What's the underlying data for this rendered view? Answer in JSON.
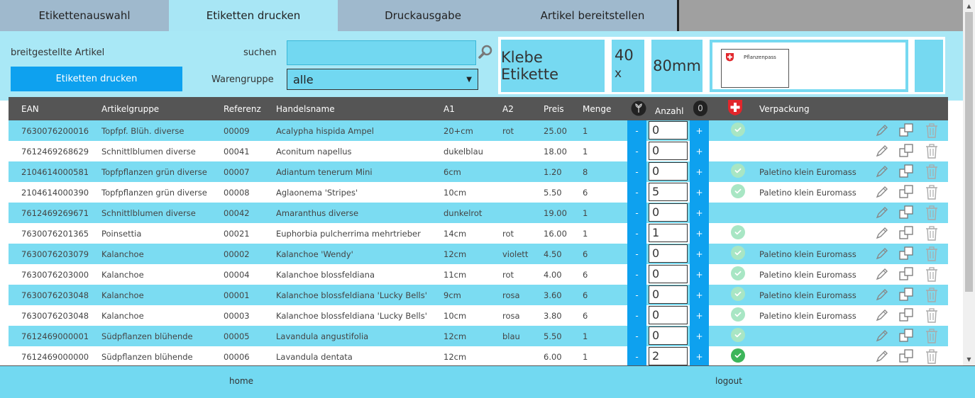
{
  "tabs": [
    {
      "label": "Etikettenauswahl"
    },
    {
      "label": "Etiketten drucken"
    },
    {
      "label": "Druckausgabe"
    },
    {
      "label": "Artikel bereitstellen"
    }
  ],
  "panel": {
    "provided_label": "breitgestellte Artikel",
    "print_button": "Etiketten drucken",
    "search_label": "suchen",
    "search_value": "",
    "group_label": "Warengruppe",
    "group_selected": "alle",
    "label_type": "Klebe Etikette",
    "label_width": "40",
    "label_x": "x",
    "label_height": "80mm",
    "pflanzenpass": "Pflanzenpass"
  },
  "columns": {
    "ean": "EAN",
    "group": "Artikelgruppe",
    "ref": "Referenz",
    "name": "Handelsname",
    "a1": "A1",
    "a2": "A2",
    "price": "Preis",
    "qty": "Menge",
    "count": "Anzahl",
    "count_total": "0",
    "packaging": "Verpackung"
  },
  "rows": [
    {
      "ean": "7630076200016",
      "group": "Topfpf. Blüh. diverse",
      "ref": "00009",
      "name": "Acalypha hispida Ampel",
      "a1": "20+cm",
      "a2": "rot",
      "price": "25.00",
      "qty": "1",
      "count": "0",
      "check": "light",
      "packaging": ""
    },
    {
      "ean": "7612469268629",
      "group": "Schnittlblumen diverse",
      "ref": "00041",
      "name": "Aconitum napellus",
      "a1": "dukelblau",
      "a2": "",
      "price": "18.00",
      "qty": "1",
      "count": "0",
      "check": "none",
      "packaging": ""
    },
    {
      "ean": "2104614000581",
      "group": "Topfpflanzen grün diverse",
      "ref": "00007",
      "name": "Adiantum tenerum Mini",
      "a1": "6cm",
      "a2": "",
      "price": "1.20",
      "qty": "8",
      "count": "0",
      "check": "light",
      "packaging": "Paletino klein Euromass"
    },
    {
      "ean": "2104614000390",
      "group": "Topfpflanzen grün diverse",
      "ref": "00008",
      "name": "Aglaonema 'Stripes'",
      "a1": "10cm",
      "a2": "",
      "price": "5.50",
      "qty": "6",
      "count": "5",
      "check": "light",
      "packaging": "Paletino klein Euromass"
    },
    {
      "ean": "7612469269671",
      "group": "Schnittlblumen diverse",
      "ref": "00042",
      "name": "Amaranthus diverse",
      "a1": "dunkelrot",
      "a2": "",
      "price": "19.00",
      "qty": "1",
      "count": "0",
      "check": "none",
      "packaging": ""
    },
    {
      "ean": "7630076201365",
      "group": "Poinsettia",
      "ref": "00021",
      "name": "Euphorbia pulcherrima mehrtrieber",
      "a1": "14cm",
      "a2": "rot",
      "price": "16.00",
      "qty": "1",
      "count": "1",
      "check": "light",
      "packaging": ""
    },
    {
      "ean": "7630076203079",
      "group": "Kalanchoe",
      "ref": "00002",
      "name": "Kalanchoe 'Wendy'",
      "a1": "12cm",
      "a2": "violett",
      "price": "4.50",
      "qty": "6",
      "count": "0",
      "check": "light",
      "packaging": "Paletino klein Euromass"
    },
    {
      "ean": "7630076203000",
      "group": "Kalanchoe",
      "ref": "00004",
      "name": "Kalanchoe blossfeldiana",
      "a1": "11cm",
      "a2": "rot",
      "price": "4.00",
      "qty": "6",
      "count": "0",
      "check": "light",
      "packaging": "Paletino klein Euromass"
    },
    {
      "ean": "7630076203048",
      "group": "Kalanchoe",
      "ref": "00001",
      "name": "Kalanchoe blossfeldiana 'Lucky Bells'",
      "a1": "9cm",
      "a2": "rosa",
      "price": "3.60",
      "qty": "6",
      "count": "0",
      "check": "light",
      "packaging": "Paletino klein Euromass"
    },
    {
      "ean": "7630076203048",
      "group": "Kalanchoe",
      "ref": "00003",
      "name": "Kalanchoe blossfeldiana 'Lucky Bells'",
      "a1": "10cm",
      "a2": "rosa",
      "price": "3.80",
      "qty": "6",
      "count": "0",
      "check": "light",
      "packaging": "Paletino klein Euromass"
    },
    {
      "ean": "7612469000001",
      "group": "Südpflanzen blühende",
      "ref": "00005",
      "name": "Lavandula angustifolia",
      "a1": "12cm",
      "a2": "blau",
      "price": "5.50",
      "qty": "1",
      "count": "0",
      "check": "light",
      "packaging": ""
    },
    {
      "ean": "7612469000000",
      "group": "Südpflanzen blühende",
      "ref": "00006",
      "name": "Lavandula dentata",
      "a1": "12cm",
      "a2": "",
      "price": "6.00",
      "qty": "1",
      "count": "2",
      "check": "strong",
      "packaging": ""
    }
  ],
  "buttons": {
    "minus": "-",
    "plus": "+"
  },
  "footer": {
    "home": "home",
    "logout": "logout"
  },
  "icons": {
    "search": "magnifier-icon",
    "plant": "plant-icon",
    "swiss": "swiss-cross-icon",
    "check": "check-circle-icon",
    "edit": "pencil-icon",
    "copy": "copy-icon",
    "delete": "trash-icon"
  },
  "colors": {
    "accent": "#0ea1ef",
    "row_highlight": "#7bdcf2",
    "panel": "#a9e8f6",
    "header": "#555555",
    "swiss_red": "#e2262b"
  }
}
